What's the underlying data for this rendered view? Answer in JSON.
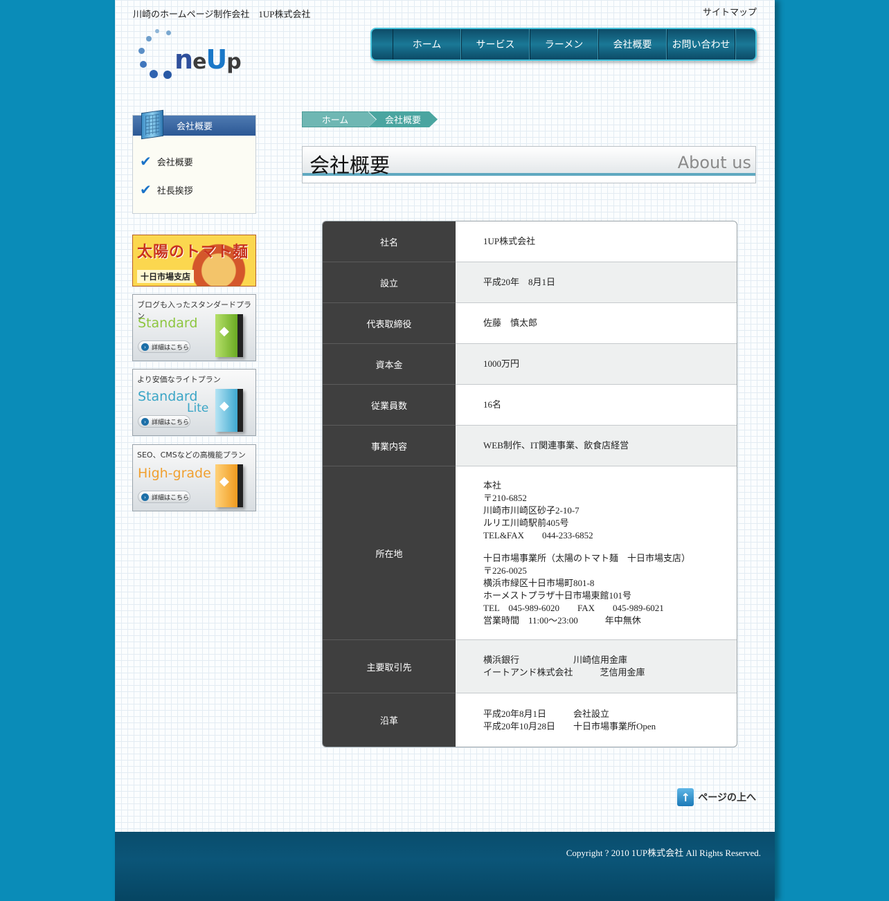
{
  "header": {
    "tagline": "川崎のホームページ制作会社　1UP株式会社",
    "sitemap": "サイトマップ",
    "logo": {
      "n": "n",
      "e": "e",
      "U": "U",
      "p": "p"
    }
  },
  "nav": [
    "ホーム",
    "サービス",
    "ラーメン",
    "会社概要",
    "お問い合わせ"
  ],
  "sidebar": {
    "heading": "会社概要",
    "items": [
      "会社概要",
      "社長挨拶"
    ]
  },
  "banners": {
    "ramen": {
      "title": "太陽のトマト麺",
      "sub": "十日市場支店"
    },
    "plans": [
      {
        "top": "ブログも入ったスタンダードプラン",
        "name": "Standard",
        "name2": "",
        "button": "詳細はこちら",
        "color": "#8dc63f"
      },
      {
        "top": "より安価なライトプラン",
        "name": "Standard",
        "name2": "Lite",
        "button": "詳細はこちら",
        "color": "#4fb8d8"
      },
      {
        "top": "SEO、CMSなどの高機能プラン",
        "name": "High-grade",
        "name2": "",
        "button": "詳細はこちら",
        "color": "#f3a32f"
      }
    ]
  },
  "breadcrumb": [
    "ホーム",
    "会社概要"
  ],
  "page_title": {
    "jp": "会社概要",
    "en": "About us"
  },
  "company_rows": [
    {
      "label": "社名",
      "lines": [
        "1UP株式会社"
      ]
    },
    {
      "label": "設立",
      "lines": [
        "平成20年　8月1日"
      ]
    },
    {
      "label": "代表取締役",
      "lines": [
        "佐藤　慎太郎"
      ]
    },
    {
      "label": "資本金",
      "lines": [
        "1000万円"
      ]
    },
    {
      "label": "従業員数",
      "lines": [
        "16名"
      ]
    },
    {
      "label": "事業内容",
      "lines": [
        "WEB制作、IT関連事業、飲食店経営"
      ]
    },
    {
      "label": "所在地",
      "lines": [
        "本社",
        "〒210-6852",
        "川崎市川崎区砂子2-10-7",
        "ルリエ川崎駅前405号",
        "TEL&FAX　　044-233-6852",
        "",
        "十日市場事業所（太陽のトマト麺　十日市場支店）",
        "〒226-0025",
        "横浜市緑区十日市場町801-8",
        "ホーメストプラザ十日市場東館101号",
        "TEL　045-989-6020　　FAX　　045-989-6021",
        "営業時間　11:00～23:00　　　年中無休"
      ]
    },
    {
      "label": "主要取引先",
      "lines": [
        "横浜銀行　　　　　　川崎信用金庫",
        "イートアンド株式会社　　　芝信用金庫"
      ]
    },
    {
      "label": "沿革",
      "lines": [
        "平成20年8月1日　　　会社設立",
        "平成20年10月28日　　十日市場事業所Open"
      ]
    }
  ],
  "pagetop": "ページの上へ",
  "footer": {
    "copyright": "Copyright ? 2010 1UP株式会社 All Rights Reserved."
  }
}
